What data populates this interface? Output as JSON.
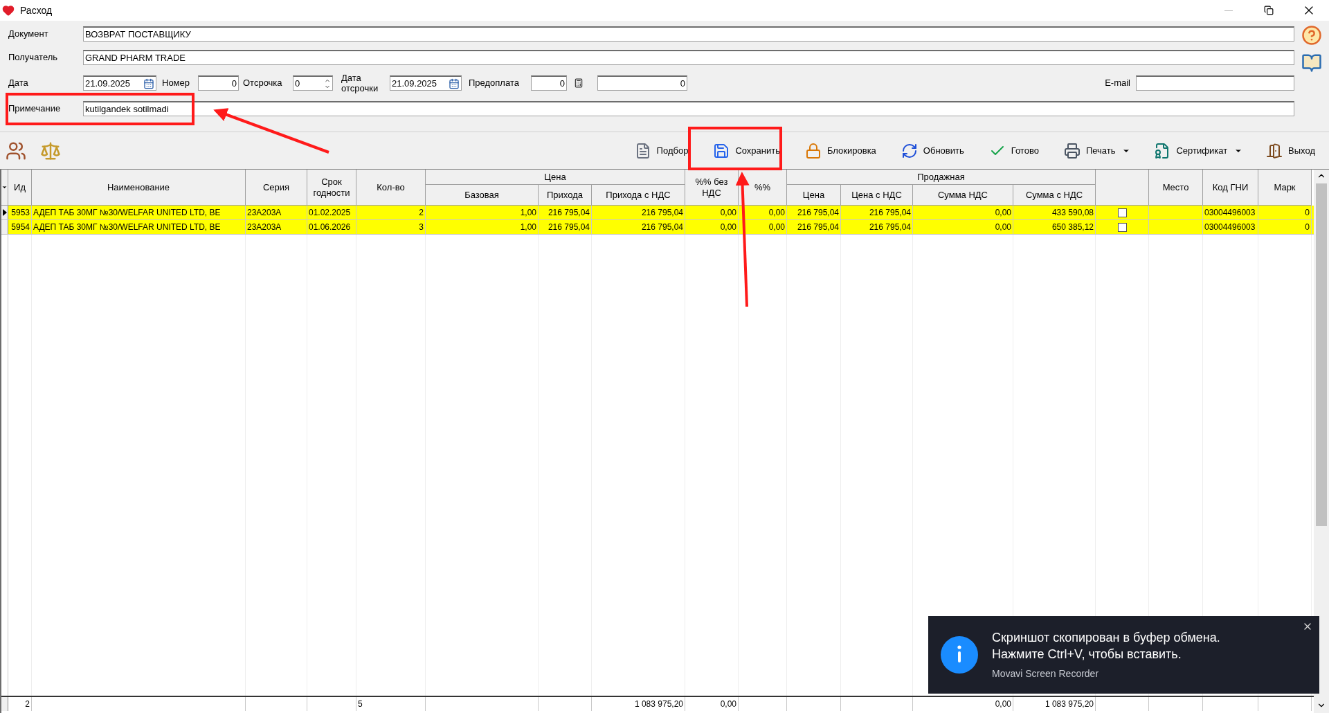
{
  "window": {
    "title": "Расход"
  },
  "form": {
    "document": {
      "label": "Документ",
      "value": "ВОЗВРАТ ПОСТАВЩИКУ"
    },
    "recipient": {
      "label": "Получатель",
      "value": "GRAND PHARM TRADE"
    },
    "date": {
      "label": "Дата",
      "value": "21.09.2025"
    },
    "number": {
      "label": "Номер",
      "value": "0"
    },
    "delay": {
      "label": "Отсрочка",
      "value": "0"
    },
    "delay_date": {
      "label": "Дата отсрочки",
      "value": "21.09.2025"
    },
    "prepayment": {
      "label": "Предоплата",
      "value": "0"
    },
    "amount": {
      "value": "0"
    },
    "email": {
      "label": "E-mail"
    },
    "note": {
      "label": "Примечание",
      "value": "kutilgandek sotilmadi"
    }
  },
  "toolbar": [
    {
      "label": "Подбор",
      "dropdown": false
    },
    {
      "label": "Сохранить",
      "dropdown": false
    },
    {
      "label": "Блокировка",
      "dropdown": false
    },
    {
      "label": "Обновить",
      "dropdown": false
    },
    {
      "label": "Готово",
      "dropdown": false
    },
    {
      "label": "Печать",
      "dropdown": true
    },
    {
      "label": "Сертификат",
      "dropdown": true
    },
    {
      "label": "Выход",
      "dropdown": false
    }
  ],
  "table": {
    "columns": [
      {
        "kind": "single",
        "label": "Ид"
      },
      {
        "kind": "single",
        "label": "Наименование"
      },
      {
        "kind": "single",
        "label": "Серия"
      },
      {
        "kind": "single",
        "label": "Срок годности"
      },
      {
        "kind": "single",
        "label": "Кол-во"
      },
      {
        "kind": "group",
        "label": "Цена",
        "children": [
          "Базовая",
          "Прихода",
          "Прихода с НДС"
        ]
      },
      {
        "kind": "single",
        "label": "%% без НДС"
      },
      {
        "kind": "single",
        "label": "%%"
      },
      {
        "kind": "group",
        "label": "Продажная",
        "children": [
          "Цена",
          "Цена с НДС",
          "Сумма НДС",
          "Сумма с НДС"
        ]
      },
      {
        "kind": "blank"
      },
      {
        "kind": "single",
        "label": "Место"
      },
      {
        "kind": "single",
        "label": "Код ГНИ"
      },
      {
        "kind": "single",
        "label": "Марк"
      }
    ],
    "rows": [
      {
        "selected": true,
        "highlighted": true,
        "id": "5953",
        "name": "АДЕП ТАБ 30МГ №30/WELFAR UNITED LTD, BE",
        "series": "23A203A",
        "expiry": "01.02.2025",
        "qty": "2",
        "base": "1,00",
        "purchase": "216 795,04",
        "purchase_vat": "216 795,04",
        "pct_no_vat": "0,00",
        "pct": "0,00",
        "sale_price": "216 795,04",
        "sale_price_vat": "216 795,04",
        "vat_sum": "0,00",
        "sum_vat": "433 590,08",
        "checked": false,
        "code": "03004496003",
        "mark": "0"
      },
      {
        "selected": false,
        "highlighted": true,
        "id": "5954",
        "name": "АДЕП ТАБ 30МГ №30/WELFAR UNITED LTD, BE",
        "series": "23A203A",
        "expiry": "01.06.2026",
        "qty": "3",
        "base": "1,00",
        "purchase": "216 795,04",
        "purchase_vat": "216 795,04",
        "pct_no_vat": "0,00",
        "pct": "0,00",
        "sale_price": "216 795,04",
        "sale_price_vat": "216 795,04",
        "vat_sum": "0,00",
        "sum_vat": "650 385,12",
        "checked": false,
        "code": "03004496003",
        "mark": "0"
      }
    ],
    "totals": {
      "id": "2",
      "qty": "5",
      "purchase_vat": "1 083 975,20",
      "pct_no_vat": "0,00",
      "vat_sum": "0,00",
      "sum_vat": "1 083 975,20"
    }
  },
  "toast": {
    "lines": [
      "Скриншот скопирован в буфер обмена.",
      "Нажмите Ctrl+V, чтобы вставить."
    ],
    "source": "Movavi Screen Recorder"
  }
}
